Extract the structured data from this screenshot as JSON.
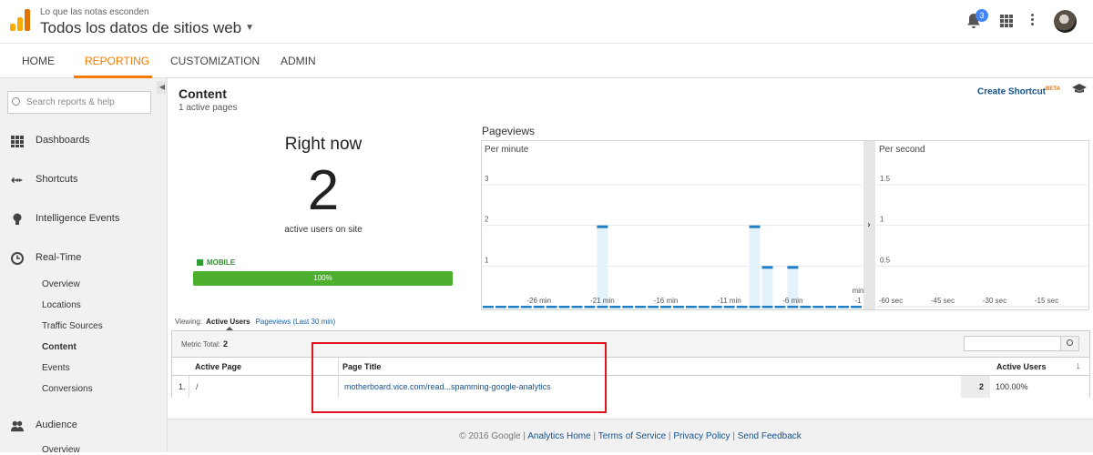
{
  "header": {
    "account_sub": "Lo que las notas esconden",
    "account_main": "Todos los datos de sitios web",
    "notifications_count": "3"
  },
  "nav": {
    "tabs": [
      {
        "label": "HOME",
        "active": false
      },
      {
        "label": "REPORTING",
        "active": true
      },
      {
        "label": "CUSTOMIZATION",
        "active": false
      },
      {
        "label": "ADMIN",
        "active": false
      }
    ]
  },
  "sidebar": {
    "search_placeholder": "Search reports & help",
    "items": [
      {
        "label": "Dashboards",
        "icon": "grid-icon"
      },
      {
        "label": "Shortcuts",
        "icon": "shortcut-arrow-icon"
      },
      {
        "label": "Intelligence Events",
        "icon": "lightbulb-icon"
      },
      {
        "label": "Real-Time",
        "icon": "clock-icon"
      },
      {
        "label": "Audience",
        "icon": "people-icon"
      }
    ],
    "realtime_sub": [
      "Overview",
      "Locations",
      "Traffic Sources",
      "Content",
      "Events",
      "Conversions"
    ],
    "audience_sub": [
      "Overview"
    ],
    "active_sub": "Content"
  },
  "content": {
    "title": "Content",
    "subtitle": "1 active pages",
    "shortcut_label": "Create Shortcut",
    "shortcut_badge": "BETA",
    "right_now_label": "Right now",
    "active_users": "2",
    "active_users_label": "active users on site",
    "device_label": "MOBILE",
    "device_percent_label": "100%",
    "device_share": 1.0,
    "pageviews_title": "Pageviews"
  },
  "chart_data": [
    {
      "type": "bar",
      "title": "Per minute",
      "x_tick_labels": [
        "-26 min",
        "-21 min",
        "-16 min",
        "-11 min",
        "-6 min",
        "-1 min"
      ],
      "y_tick_labels": [
        "1",
        "2",
        "3"
      ],
      "ylim": [
        0,
        3
      ],
      "minutes_ago": [
        30,
        29,
        28,
        27,
        26,
        25,
        24,
        23,
        22,
        21,
        20,
        19,
        18,
        17,
        16,
        15,
        14,
        13,
        12,
        11,
        10,
        9,
        8,
        7,
        6,
        5,
        4,
        3,
        2,
        1
      ],
      "values": [
        0,
        0,
        0,
        0,
        0,
        0,
        0,
        0,
        0,
        2,
        0,
        0,
        0,
        0,
        0,
        0,
        0,
        0,
        0,
        0,
        0,
        2,
        1,
        0,
        1,
        0,
        0,
        0,
        0,
        0
      ],
      "colors": {
        "bar_fill": "#e3f2fb",
        "bar_top": "#1f7fc4",
        "grid": "#e8e8e8"
      }
    },
    {
      "type": "bar",
      "title": "Per second",
      "x_tick_labels": [
        "-60 sec",
        "-45 sec",
        "-30 sec",
        "-15 sec"
      ],
      "y_tick_labels": [
        "0.5",
        "1",
        "1.5"
      ],
      "ylim": [
        0,
        1.5
      ],
      "values": []
    }
  ],
  "table": {
    "viewing_label": "Viewing:",
    "viewing_active": "Active Users",
    "viewing_alt": "Pageviews (Last 30 min)",
    "metric_total_label": "Metric Total:",
    "metric_total_value": "2",
    "columns": [
      "Active Page",
      "Page Title",
      "Active Users"
    ],
    "rows": [
      {
        "index": "1.",
        "page": "/",
        "title": "motherboard.vice.com/read...spamming-google-analytics",
        "users": "2",
        "percent": "100.00%"
      }
    ]
  },
  "footer": {
    "copyright": "© 2016 Google |",
    "links": [
      "Analytics Home",
      "Terms of Service",
      "Privacy Policy",
      "Send Feedback"
    ]
  },
  "colors": {
    "accent": "#f57c00",
    "link": "#15518c",
    "mobile_bar": "#4caf2e",
    "highlight_box": "#e0141e"
  }
}
